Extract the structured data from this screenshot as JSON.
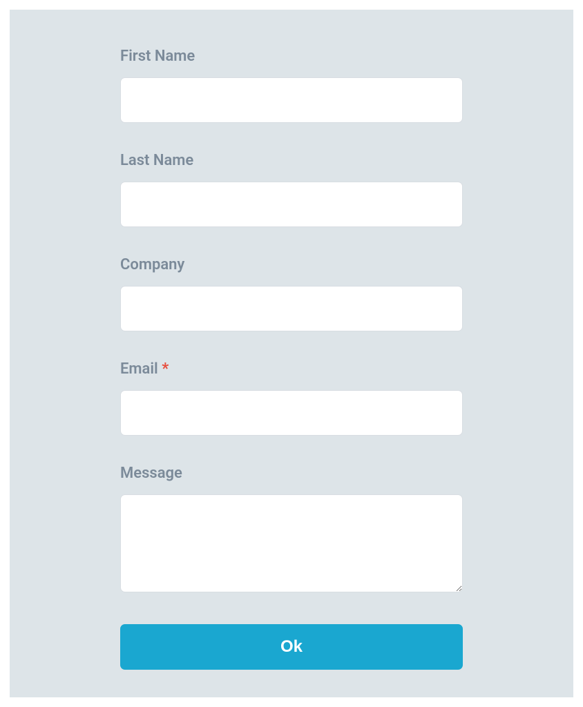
{
  "form": {
    "fields": {
      "first_name": {
        "label": "First Name",
        "value": "",
        "required": false
      },
      "last_name": {
        "label": "Last Name",
        "value": "",
        "required": false
      },
      "company": {
        "label": "Company",
        "value": "",
        "required": false
      },
      "email": {
        "label": "Email",
        "value": "",
        "required": true,
        "required_marker": "*"
      },
      "message": {
        "label": "Message",
        "value": "",
        "required": false
      }
    },
    "submit_label": "Ok"
  }
}
